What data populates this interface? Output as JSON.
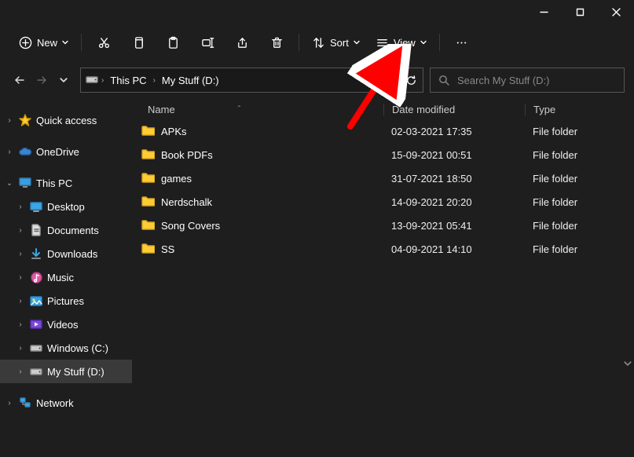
{
  "window_controls": {
    "minimize": "minimize",
    "maximize": "maximize",
    "close": "close"
  },
  "toolbar": {
    "new_label": "New",
    "sort_label": "Sort",
    "view_label": "View"
  },
  "breadcrumb": {
    "items": [
      "This PC",
      "My Stuff (D:)"
    ]
  },
  "search": {
    "placeholder": "Search My Stuff (D:)"
  },
  "sidebar": {
    "quick_access": "Quick access",
    "onedrive": "OneDrive",
    "this_pc": "This PC",
    "desktop": "Desktop",
    "documents": "Documents",
    "downloads": "Downloads",
    "music": "Music",
    "pictures": "Pictures",
    "videos": "Videos",
    "windows_c": "Windows (C:)",
    "my_stuff_d": "My Stuff (D:)",
    "network": "Network"
  },
  "columns": {
    "name": "Name",
    "date": "Date modified",
    "type": "Type"
  },
  "rows": [
    {
      "name": "APKs",
      "date": "02-03-2021 17:35",
      "type": "File folder"
    },
    {
      "name": "Book PDFs",
      "date": "15-09-2021 00:51",
      "type": "File folder"
    },
    {
      "name": "games",
      "date": "31-07-2021 18:50",
      "type": "File folder"
    },
    {
      "name": "Nerdschalk",
      "date": "14-09-2021 20:20",
      "type": "File folder"
    },
    {
      "name": "Song Covers",
      "date": "13-09-2021 05:41",
      "type": "File folder"
    },
    {
      "name": "SS",
      "date": "04-09-2021 14:10",
      "type": "File folder"
    }
  ]
}
